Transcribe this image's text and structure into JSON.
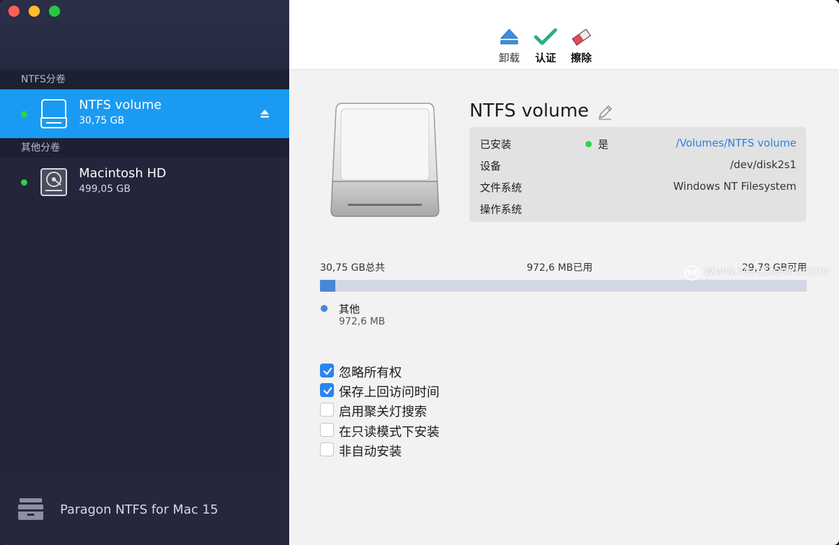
{
  "sidebar": {
    "ntfs_section_label": "NTFS分卷",
    "other_section_label": "其他分卷",
    "ntfs_volumes": [
      {
        "name": "NTFS volume",
        "size": "30,75 GB",
        "status_color": "#2fd34a",
        "icon": "drive-icon"
      }
    ],
    "other_volumes": [
      {
        "name": "Macintosh HD",
        "size": "499,05 GB",
        "status_color": "#2fd34a",
        "icon": "hard-disk-icon"
      }
    ],
    "footer": {
      "app_name": "Paragon NTFS for Mac 15",
      "icon": "paragon-logo-icon"
    }
  },
  "toolbar": {
    "unmount_label": "卸载",
    "verify_label": "认证",
    "erase_label": "擦除"
  },
  "volume": {
    "title": "NTFS volume",
    "info": {
      "mounted_label": "已安装",
      "mounted_value": "是",
      "mount_path": "/Volumes/NTFS volume",
      "device_label": "设备",
      "device_value": "/dev/disk2s1",
      "filesystem_label": "文件系统",
      "filesystem_value": "Windows NT Filesystem",
      "os_label": "操作系统",
      "os_value": ""
    },
    "usage": {
      "total_label": "30,75 GB总共",
      "used_label": "972,6 MB已用",
      "free_label": "29,78 GB可用",
      "used_fraction": 0.0316,
      "legend_name": "其他",
      "legend_value": "972,6 MB",
      "used_color": "#4a86d8"
    },
    "options": [
      {
        "label": "忽略所有权",
        "checked": true
      },
      {
        "label": "保存上回访问时间",
        "checked": true
      },
      {
        "label": "启用聚关灯搜索",
        "checked": false
      },
      {
        "label": "在只读模式下安装",
        "checked": false
      },
      {
        "label": "非自动安装",
        "checked": false
      }
    ]
  },
  "watermark": {
    "text": "www.MacDown.com"
  }
}
